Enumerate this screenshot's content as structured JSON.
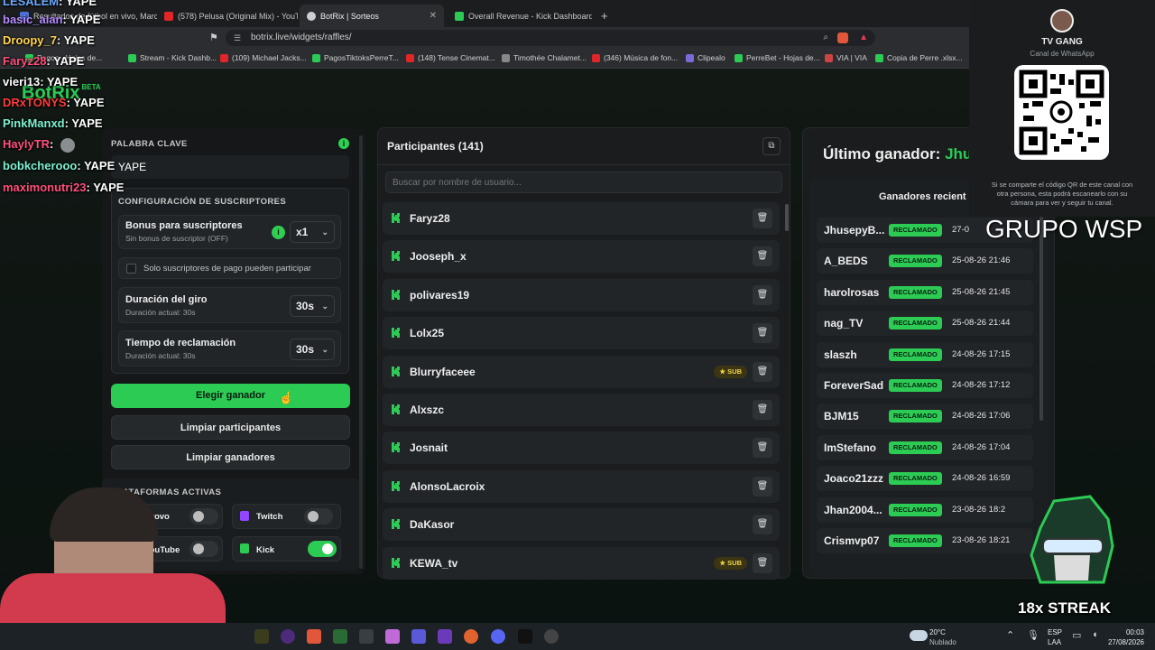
{
  "browser": {
    "tabs": [
      {
        "label": "Resultados de fútbol en vivo, Marcad"
      },
      {
        "label": "(578) Pelusa (Original Mix) - YouT"
      },
      {
        "label": "BotRix | Sorteos"
      },
      {
        "label": "Overall Revenue - Kick Dashboard"
      }
    ],
    "url": "botrix.live/widgets/raffles/",
    "bookmarks": [
      "Pagos - Hojas de...",
      "Stream - Kick Dashb...",
      "(109) Michael Jacks...",
      "PagosTiktoksPerreT...",
      "(148) Tense Cinemat...",
      "Timothée Chalamet...",
      "(346) Música de fon...",
      "Clipealo",
      "PerreBet - Hojas de...",
      "VIA | VIA",
      "Copia de Perre .xlsx..."
    ]
  },
  "logo": {
    "name": "BotRix",
    "beta": "BETA"
  },
  "chat_overlay": [
    {
      "user": "LESALEM",
      "msg": "YAPE",
      "color": "#6aa8ff"
    },
    {
      "user": "basic_alan",
      "msg": "YAPE",
      "color": "#b48cff"
    },
    {
      "user": "Droopy_7",
      "msg": "YAPE",
      "color": "#ffd34a"
    },
    {
      "user": "Faryz28",
      "msg": "YAPE",
      "color": "#ff4f7b"
    },
    {
      "user": "vieri13",
      "msg": "YAPE",
      "color": "#ffffff"
    },
    {
      "user": "DRxTONYS",
      "msg": "YAPE",
      "color": "#ff3b3b"
    },
    {
      "user": "PinkManxd",
      "msg": "YAPE",
      "color": "#7cf0d0"
    },
    {
      "user": "HaylyTR",
      "msg": "",
      "color": "#ff4f7b"
    },
    {
      "user": "bobkcherooo",
      "msg": "YAPE",
      "color": "#7cf0d0"
    },
    {
      "user": "maximonutri23",
      "msg": "YAPE",
      "color": "#ff4f7b"
    }
  ],
  "left_panel": {
    "keyword_label": "PALABRA CLAVE",
    "keyword_value": "YAPE",
    "subs_section": "CONFIGURACIÓN DE SUSCRIPTORES",
    "bonus_title": "Bonus para suscriptores",
    "bonus_desc": "Sin bonus de suscriptor (OFF)",
    "bonus_value": "x1",
    "paid_only": "Solo suscriptores de pago pueden participar",
    "spin_title": "Duración del giro",
    "spin_desc": "Duración actual: 30s",
    "spin_value": "30s",
    "claim_title": "Tiempo de reclamación",
    "claim_desc": "Duración actual: 30s",
    "claim_value": "30s",
    "btn_pick": "Elegir ganador",
    "btn_clear_participants": "Limpiar participantes",
    "btn_clear_winners": "Limpiar ganadores",
    "platforms_label": "PLATAFORMAS ACTIVAS",
    "platforms": [
      {
        "name": "Trovo",
        "on": false
      },
      {
        "name": "Twitch",
        "on": false
      },
      {
        "name": "YouTube",
        "on": false
      },
      {
        "name": "Kick",
        "on": true
      }
    ]
  },
  "participants": {
    "title": "Participantes (141)",
    "search_placeholder": "Buscar por nombre de usuario...",
    "sub_label": "SUB",
    "items": [
      {
        "name": "Faryz28",
        "sub": false
      },
      {
        "name": "Jooseph_x",
        "sub": false
      },
      {
        "name": "polivares19",
        "sub": false
      },
      {
        "name": "Lolx25",
        "sub": false
      },
      {
        "name": "Blurryfaceee",
        "sub": true
      },
      {
        "name": "Alxszc",
        "sub": false
      },
      {
        "name": "Josnait",
        "sub": false
      },
      {
        "name": "AlonsoLacroix",
        "sub": false
      },
      {
        "name": "DaKasor",
        "sub": false
      },
      {
        "name": "KEWA_tv",
        "sub": true
      }
    ]
  },
  "winners": {
    "last_winner_label": "Último ganador:",
    "last_winner_name": "Jhu",
    "recent_title": "Ganadores recient",
    "badge": "RECLAMADO",
    "items": [
      {
        "name": "JhusepyB...",
        "date": "27-0"
      },
      {
        "name": "A_BEDS",
        "date": "25-08-26 21:46"
      },
      {
        "name": "harolrosas",
        "date": "25-08-26 21:45"
      },
      {
        "name": "nag_TV",
        "date": "25-08-26 21:44"
      },
      {
        "name": "slaszh",
        "date": "24-08-26 17:15"
      },
      {
        "name": "ForeverSad",
        "date": "24-08-26 17:12"
      },
      {
        "name": "BJM15",
        "date": "24-08-26 17:06"
      },
      {
        "name": "ImStefano",
        "date": "24-08-26 17:04"
      },
      {
        "name": "Joaco21zzz",
        "date": "24-08-26 16:59"
      },
      {
        "name": "Jhan2004...",
        "date": "23-08-26 18:2"
      },
      {
        "name": "Crismvp07",
        "date": "23-08-26 18:21"
      }
    ]
  },
  "whatsapp_card": {
    "name": "TV GANG",
    "subtitle": "Canal de WhatsApp",
    "note": "Si se comparte el código QR de este canal con otra persona, esta podrá escanearlo con su cámara para ver y seguir tu canal."
  },
  "overlay_text": {
    "group": "GRUPO WSP",
    "streak": "18x STREAK"
  },
  "taskbar": {
    "weather_temp": "20°C",
    "weather_desc": "Nublado",
    "lang": "ESP",
    "lang_sub": "LAA",
    "time": "00:03",
    "date": "27/08/2026"
  },
  "colors": {
    "accent": "#2bcb54",
    "panel": "#1a1c1e",
    "row": "#222528"
  }
}
